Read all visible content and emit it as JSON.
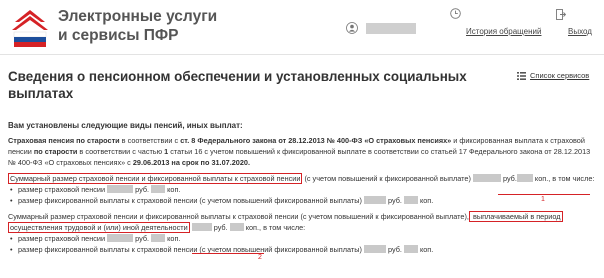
{
  "header": {
    "brand_line1": "Электронные услуги",
    "brand_line2": "и сервисы ПФР",
    "history_link": "История обращений",
    "logout_link": "Выход",
    "user_icon": "user-icon",
    "history_icon": "clock-icon",
    "logout_icon": "exit-icon"
  },
  "page": {
    "title": "Сведения о пенсионном обеспечении и установленных социальных выплатах",
    "services_link": "Список сервисов",
    "services_icon": "grid-icon"
  },
  "content": {
    "heading": "Вам установлены следующие виды пенсий, иных выплат:",
    "p1_a": "Страховая пенсия по старости",
    "p1_b": " в соответствии с ",
    "p1_c": "ст. 8 Федерального закона от 28.12.2013 № 400-ФЗ «О страховых пенсиях»",
    "p1_d": " и фиксированная выплата к страховой пенсии ",
    "p1_e": "по старости",
    "p1_f": " в соответствии с частью ",
    "p1_g": "1",
    "p1_h": " статьи 16 с учетом повышений к фиксированной выплате в соответствии со статьей 17 Федерального закона от 28.12.2013 № 400-ФЗ «О страховых пенсиях» с ",
    "p1_i": "29.06.2013 на срок по 31.07.2020.",
    "p2_a": "Суммарный размер страховой пенсии и фиксированной выплаты к страховой пенсии",
    "p2_b": " (с учетом повышений к фиксированной выплате) ",
    "rub": "руб.",
    "kop": "коп.",
    "p2_c": ", в том числе:",
    "li1_a": "размер страховой пенсии ",
    "li2_a": "размер фиксированной выплаты к страховой пенсии (с учетом повышений фиксированной выплаты) ",
    "p3_a": "Суммарный размер страховой пенсии и фиксированной выплаты к страховой пенсии (с учетом повышений к фиксированной выплате),",
    "p3_b": " выплачиваемый в период",
    "p3_c": "осуществления трудовой и (или) иной деятельности",
    "p3_d": ", в том числе:",
    "li3_a": "размер страховой пенсии ",
    "li4_a": "размер фиксированной выплаты к страховой пенсии (с учетом повышений фиксированной выплаты) ",
    "mark1": "1",
    "mark2": "2"
  },
  "colors": {
    "accent_red": "#d52226",
    "logo_blue": "#1d4f9c",
    "masked_gray": "#c9c9c9"
  }
}
